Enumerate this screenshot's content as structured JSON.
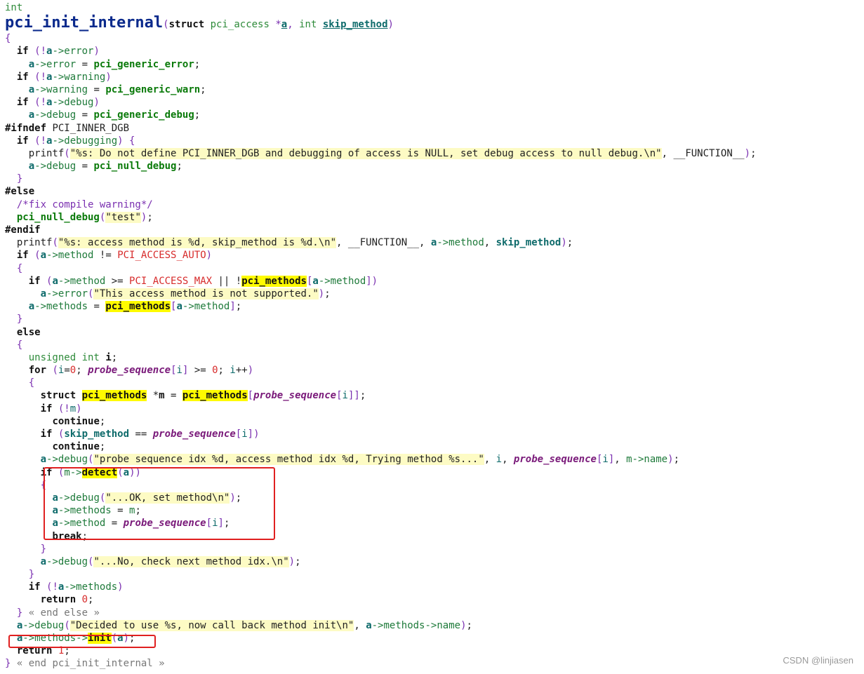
{
  "code": {
    "return_type": "int",
    "function_name": "pci_init_internal",
    "param_struct": "struct",
    "param_type": "pci_access",
    "param_a": "a",
    "param_int": "int",
    "param_skip": "skip_method",
    "end_else_marker": "« end else »",
    "end_func_marker": "« end pci_init_internal »"
  },
  "strings": {
    "no_define": "\"%s: Do not define PCI_INNER_DGB and debugging of access is NULL, set debug access to null debug.\\n\"",
    "test": "\"test\"",
    "access_method": "\"%s: access method is %d, skip_method is %d.\\n\"",
    "not_supported": "\"This access method is not supported.\"",
    "probe_seq": "\"probe sequence idx %d, access method idx %d, Trying method %s...\"",
    "ok_set": "\"...OK, set method\\n\"",
    "no_check": "\"...No, check next method idx.\\n\"",
    "decided": "\"Decided to use %s, now call back method init\\n\""
  },
  "comment": "/*fix compile warning*/",
  "watermark": "CSDN @linjiasen"
}
